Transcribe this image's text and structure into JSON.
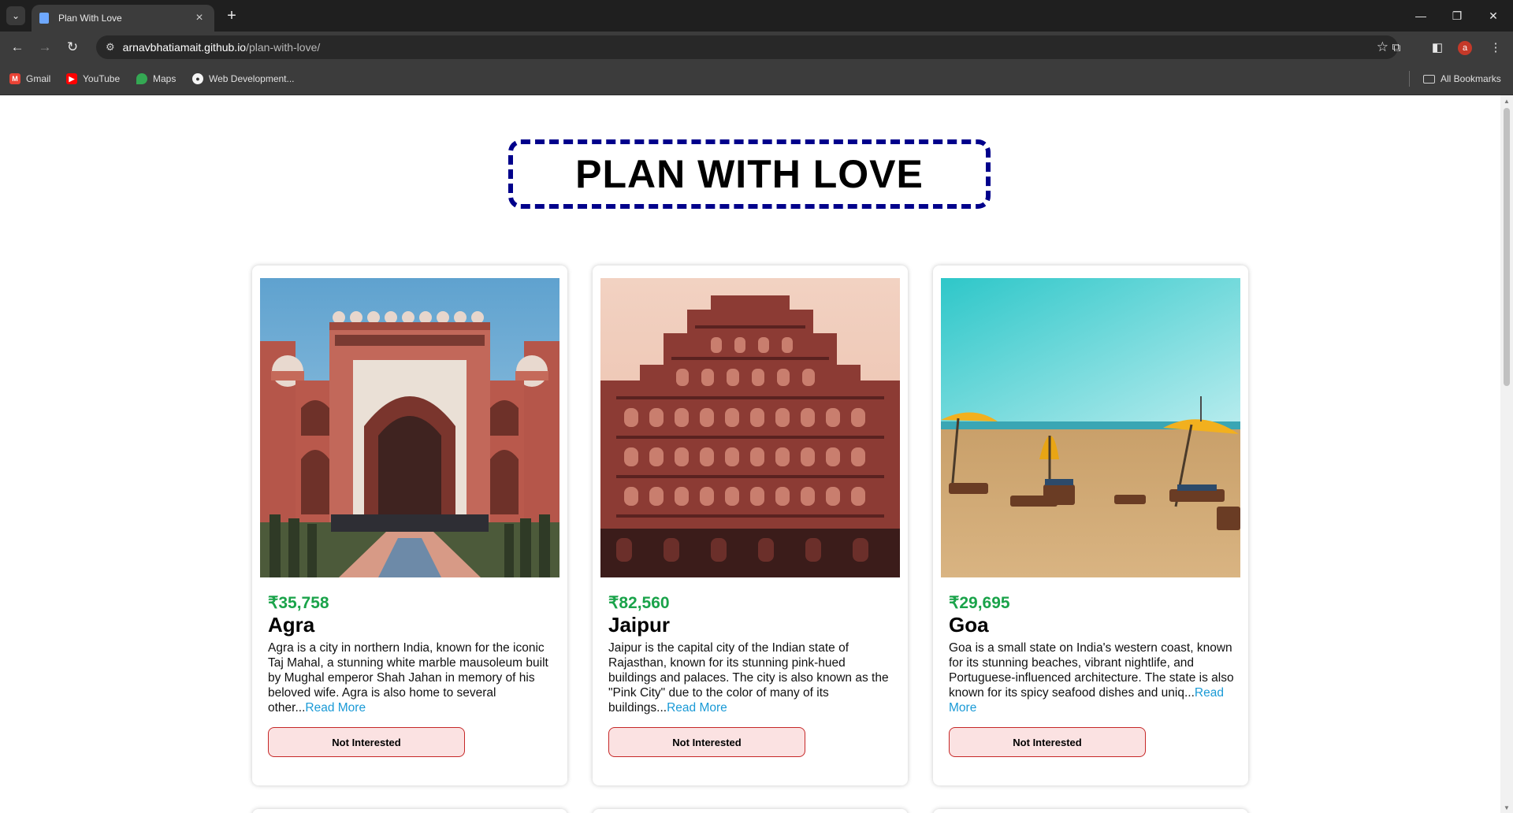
{
  "browser": {
    "tab": {
      "title": "Plan With Love"
    },
    "address": {
      "host": "arnavbhatiamait.github.io",
      "path": "/plan-with-love/"
    },
    "bookmarks": [
      {
        "label": "Gmail",
        "icon": "gmail-icon",
        "color": "#ea4335"
      },
      {
        "label": "YouTube",
        "icon": "youtube-icon",
        "color": "#ff0000"
      },
      {
        "label": "Maps",
        "icon": "maps-icon",
        "color": "#34a853"
      },
      {
        "label": "Web Development...",
        "icon": "web-dev-icon",
        "color": "#f5f5f5"
      }
    ],
    "all_bookmarks": "All Bookmarks",
    "profile_initial": "a"
  },
  "page": {
    "heading": "PLAN WITH LOVE",
    "colors": {
      "heading_border": "#00008b",
      "price": "#1aa34a",
      "link": "#1a9ad6",
      "button_bg": "#fbe2e2",
      "button_border": "#c62828"
    },
    "tours": [
      {
        "price": "₹35,758",
        "name": "Agra",
        "description": "Agra is a city in northern India, known for the iconic Taj Mahal, a stunning white marble mausoleum built by Mughal emperor Shah Jahan in memory of his beloved wife. Agra is also home to several other...",
        "read_more": "Read More",
        "button": "Not Interested"
      },
      {
        "price": "₹82,560",
        "name": "Jaipur",
        "description": "Jaipur is the capital city of the Indian state of Rajasthan, known for its stunning pink-hued buildings and palaces. The city is also known as the \"Pink City\" due to the color of many of its buildings...",
        "read_more": "Read More",
        "button": "Not Interested"
      },
      {
        "price": "₹29,695",
        "name": "Goa",
        "description": "Goa is a small state on India's western coast, known for its stunning beaches, vibrant nightlife, and Portuguese-influenced architecture. The state is also known for its spicy seafood dishes and uniq...",
        "read_more": "Read More",
        "button": "Not Interested"
      }
    ]
  }
}
